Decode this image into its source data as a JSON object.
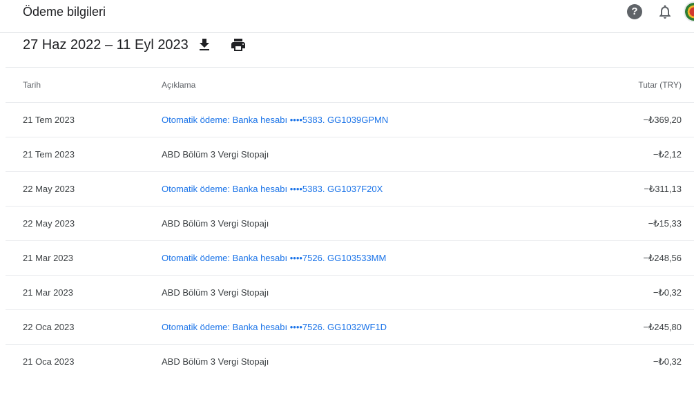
{
  "header": {
    "title": "Ödeme bilgileri",
    "help_icon": "help-circle-icon",
    "notifications_icon": "bell-icon",
    "avatar_icon": "user-avatar"
  },
  "range": {
    "label": "27 Haz 2022 – 11 Eyl 2023",
    "download_icon": "download-icon",
    "print_icon": "print-icon"
  },
  "table": {
    "columns": {
      "date": "Tarih",
      "description": "Açıklama",
      "amount": "Tutar (TRY)"
    },
    "rows": [
      {
        "date": "21 Tem 2023",
        "description": "Otomatik ödeme: Banka hesabı ••••5383. GG1039GPMN",
        "amount": "−₺369,20",
        "is_link": true
      },
      {
        "date": "21 Tem 2023",
        "description": "ABD Bölüm 3 Vergi Stopajı",
        "amount": "−₺2,12",
        "is_link": false
      },
      {
        "date": "22 May 2023",
        "description": "Otomatik ödeme: Banka hesabı ••••5383. GG1037F20X",
        "amount": "−₺311,13",
        "is_link": true
      },
      {
        "date": "22 May 2023",
        "description": "ABD Bölüm 3 Vergi Stopajı",
        "amount": "−₺15,33",
        "is_link": false
      },
      {
        "date": "21 Mar 2023",
        "description": "Otomatik ödeme: Banka hesabı ••••7526. GG103533MM",
        "amount": "−₺248,56",
        "is_link": true
      },
      {
        "date": "21 Mar 2023",
        "description": "ABD Bölüm 3 Vergi Stopajı",
        "amount": "−₺0,32",
        "is_link": false
      },
      {
        "date": "22 Oca 2023",
        "description": "Otomatik ödeme: Banka hesabı ••••7526. GG1032WF1D",
        "amount": "−₺245,80",
        "is_link": true
      },
      {
        "date": "21 Oca 2023",
        "description": "ABD Bölüm 3 Vergi Stopajı",
        "amount": "−₺0,32",
        "is_link": false
      }
    ]
  },
  "colors": {
    "link": "#1a73e8",
    "text": "#202124",
    "muted": "#5f6368",
    "divider": "#e8eaed"
  }
}
